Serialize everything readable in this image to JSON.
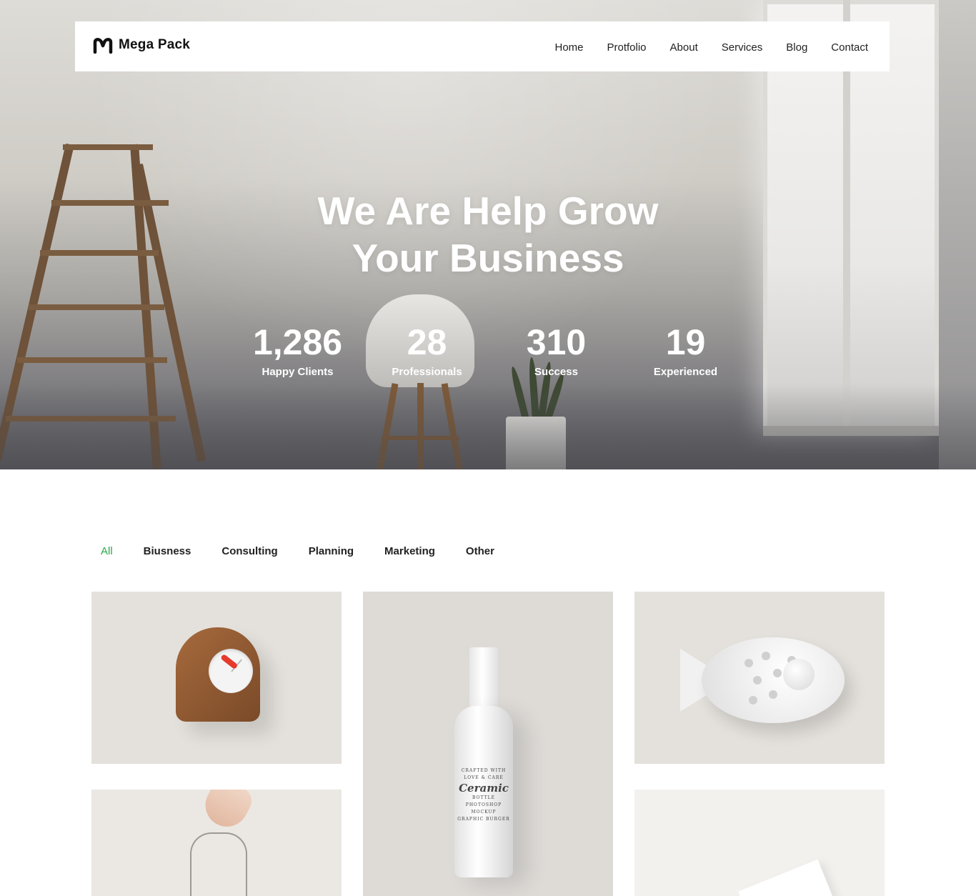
{
  "header": {
    "logo_text": "Mega Pack",
    "nav": [
      "Home",
      "Protfolio",
      "About",
      "Services",
      "Blog",
      "Contact"
    ]
  },
  "hero": {
    "title_line1": "We Are Help Grow",
    "title_line2": "Your Business",
    "stats": [
      {
        "value": "1,286",
        "label": "Happy Clients"
      },
      {
        "value": "28",
        "label": "Professionals"
      },
      {
        "value": "310",
        "label": "Success"
      },
      {
        "value": "19",
        "label": "Experienced"
      }
    ]
  },
  "portfolio": {
    "filters": [
      "All",
      "Biusness",
      "Consulting",
      "Planning",
      "Marketing",
      "Other"
    ],
    "active_filter": "All",
    "active_color": "#28a745",
    "items": [
      {
        "name": "wooden-clock"
      },
      {
        "name": "ceramic-bottle",
        "label_lines": [
          "CRAFTED WITH",
          "LOVE & CARE",
          "Ceramic",
          "BOTTLE",
          "PHOTOSHOP",
          "MOCKUP",
          "GRAPHIC BURGER"
        ]
      },
      {
        "name": "ceramic-fish"
      },
      {
        "name": "hand-bag"
      },
      {
        "name": "paper-card"
      }
    ]
  }
}
